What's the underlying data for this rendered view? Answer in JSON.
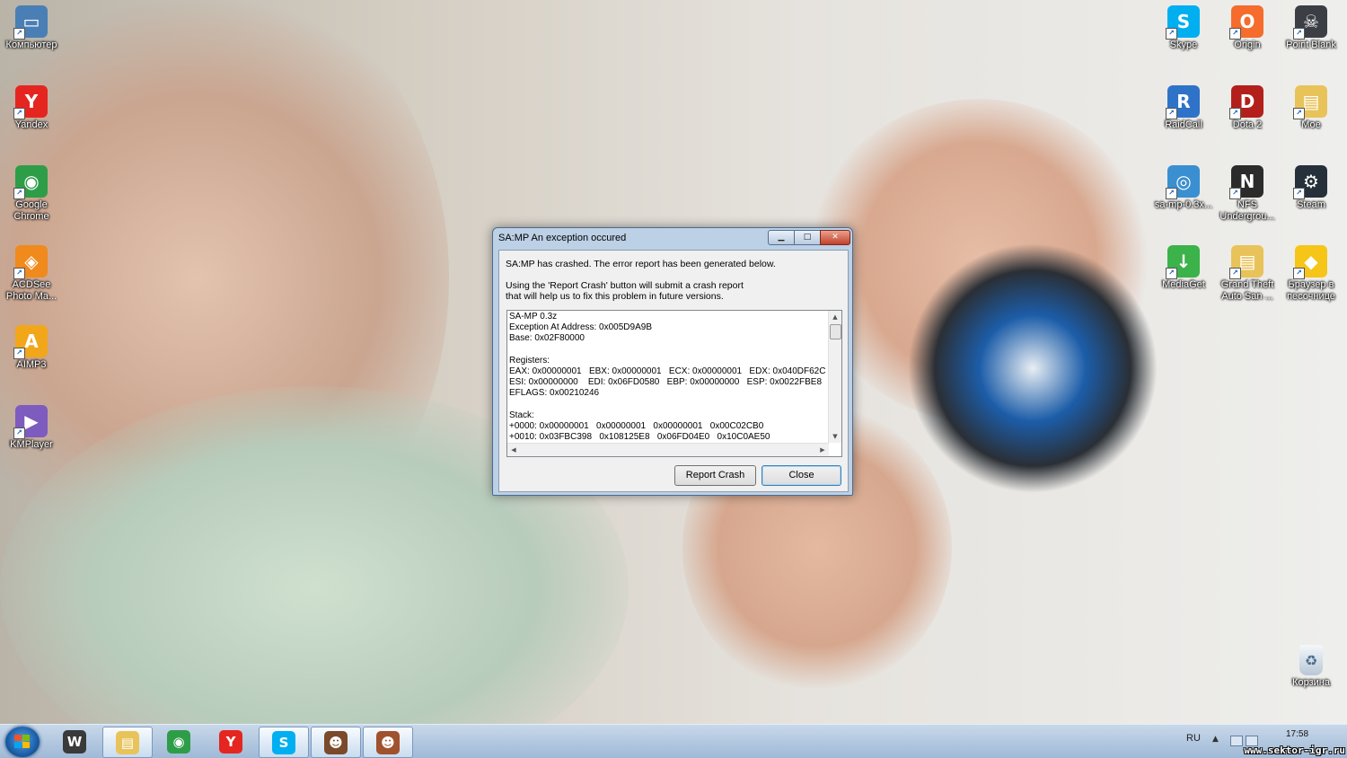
{
  "desktop": {
    "left_icons": [
      {
        "label": "Компьютер",
        "icon": "computer-icon",
        "color": "#4a7fb5"
      },
      {
        "label": "Yandex",
        "icon": "yandex-browser-icon",
        "color": "#e52620"
      },
      {
        "label": "Google Chrome",
        "icon": "chrome-icon",
        "color": "#2e9d48"
      },
      {
        "label": "ACDSee Photo Ma...",
        "icon": "acdsee-icon",
        "color": "#f08a1c"
      },
      {
        "label": "AIMP3",
        "icon": "aimp-icon",
        "color": "#f2a61a"
      },
      {
        "label": "KMPlayer",
        "icon": "kmplayer-icon",
        "color": "#7d5bbf"
      }
    ],
    "right_icons": [
      {
        "label": "Skype",
        "icon": "skype-icon",
        "color": "#00aff0"
      },
      {
        "label": "Origin",
        "icon": "origin-icon",
        "color": "#f56c2d"
      },
      {
        "label": "Point Blank",
        "icon": "point-blank-icon",
        "color": "#3b3f45"
      },
      {
        "label": "RaidCall",
        "icon": "raidcall-icon",
        "color": "#2f73c8"
      },
      {
        "label": "Dota 2",
        "icon": "dota2-icon",
        "color": "#b3201c"
      },
      {
        "label": "Мое",
        "icon": "folder-icon",
        "color": "#e8c35a"
      },
      {
        "label": "sa-mp-0.3x...",
        "icon": "samp-installer-icon",
        "color": "#3a8fd0"
      },
      {
        "label": "NFS Undergrou...",
        "icon": "nfs-icon",
        "color": "#2b2b2b"
      },
      {
        "label": "Steam",
        "icon": "steam-icon",
        "color": "#25303a"
      },
      {
        "label": "MediaGet",
        "icon": "mediaget-icon",
        "color": "#3bb24a"
      },
      {
        "label": "Grand Theft Auto San ...",
        "icon": "folder-icon",
        "color": "#e8c35a"
      },
      {
        "label": "Браузер в песочнице",
        "icon": "sandbox-browser-icon",
        "color": "#f5c518"
      }
    ],
    "recycle_bin": {
      "label": "Корзина",
      "icon": "recycle-bin-icon"
    }
  },
  "dialog": {
    "title": "SA:MP An exception occured",
    "message1": "SA:MP has crashed. The error report has been generated below.",
    "message2_line1": "Using the 'Report Crash' button will submit a crash report",
    "message2_line2": "that will help us to fix this problem in future versions.",
    "report_lines": [
      "SA-MP 0.3z",
      "Exception At Address: 0x005D9A9B",
      "Base: 0x02F80000",
      "",
      "Registers:",
      "EAX: 0x00000001   EBX: 0x00000001   ECX: 0x00000001   EDX: 0x040DF62C",
      "ESI: 0x00000000    EDI: 0x06FD0580   EBP: 0x00000000   ESP: 0x0022FBE8",
      "EFLAGS: 0x00210246",
      "",
      "Stack:",
      "+0000: 0x00000001   0x00000001   0x00000001   0x00C02CB0",
      "+0010: 0x03FBC398   0x108125E8   0x06FD04E0   0x10C0AE50"
    ],
    "report_button": "Report Crash",
    "close_button": "Close"
  },
  "taskbar": {
    "apps": [
      {
        "name": "world-of-tanks-icon",
        "color": "#3a3a3a",
        "glyph": "W",
        "active": false
      },
      {
        "name": "explorer-icon",
        "color": "#e8c35a",
        "glyph": "▤",
        "active": true
      },
      {
        "name": "chrome-icon",
        "color": "#2e9d48",
        "glyph": "◉",
        "active": false
      },
      {
        "name": "yandex-browser-icon",
        "color": "#e52620",
        "glyph": "Y",
        "active": false
      },
      {
        "name": "skype-icon",
        "color": "#00aff0",
        "glyph": "S",
        "active": true
      },
      {
        "name": "gta-sa-icon",
        "color": "#7a4a2a",
        "glyph": "☻",
        "active": true
      },
      {
        "name": "samp-icon",
        "color": "#a0522d",
        "glyph": "☻",
        "active": true
      }
    ],
    "language": "RU",
    "time": "17:58"
  },
  "watermark": "www.sektor-igr.ru"
}
